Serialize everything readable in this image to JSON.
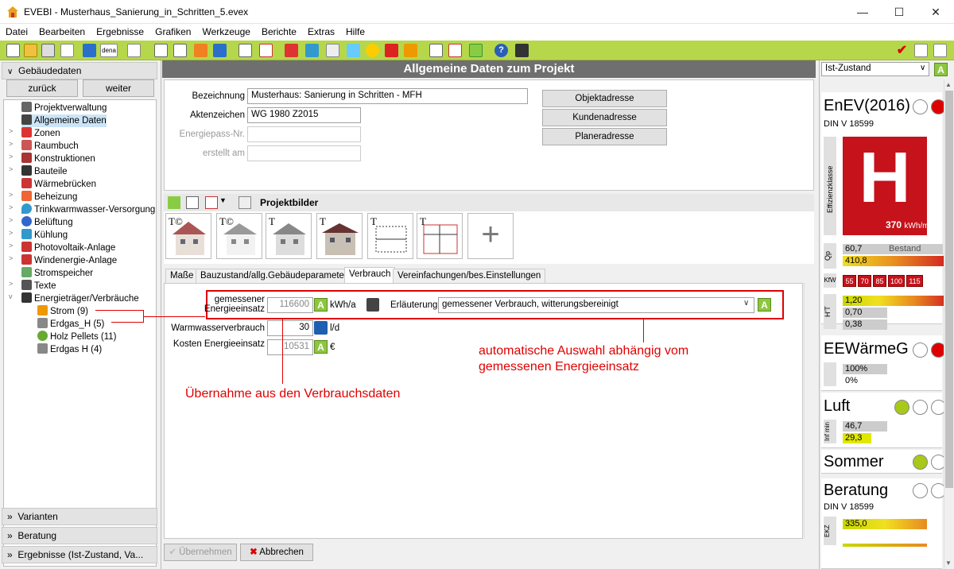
{
  "window": {
    "title": "EVEBI - Musterhaus_Sanierung_in_Schritten_5.evex",
    "minimize": "—",
    "maximize": "☐",
    "close": "✕"
  },
  "menu": [
    "Datei",
    "Bearbeiten",
    "Ergebnisse",
    "Grafiken",
    "Werkzeuge",
    "Berichte",
    "Extras",
    "Hilfe"
  ],
  "left": {
    "header": "Gebäudedaten",
    "back": "zurück",
    "forward": "weiter",
    "tree": [
      {
        "label": "Projektverwaltung",
        "color": "#555"
      },
      {
        "label": "Allgemeine Daten",
        "color": "#444"
      },
      {
        "label": "Zonen",
        "color": "#d33"
      },
      {
        "label": "Raumbuch",
        "color": "#c55"
      },
      {
        "label": "Konstruktionen",
        "color": "#a33"
      },
      {
        "label": "Bauteile",
        "color": "#333"
      },
      {
        "label": "Wärmebrücken",
        "color": "#c33"
      },
      {
        "label": "Beheizung",
        "color": "#e63"
      },
      {
        "label": "Trinkwarmwasser-Versorgung",
        "color": "#39c"
      },
      {
        "label": "Belüftung",
        "color": "#36c"
      },
      {
        "label": "Kühlung",
        "color": "#39c"
      },
      {
        "label": "Photovoltaik-Anlage",
        "color": "#c33"
      },
      {
        "label": "Windenergie-Anlage",
        "color": "#c33"
      },
      {
        "label": "Stromspeicher",
        "color": "#6a6"
      },
      {
        "label": "Texte",
        "color": "#555"
      },
      {
        "label": "Energieträger/Verbräuche",
        "color": "#333"
      },
      {
        "label": "Strom (9)",
        "color": "#e90"
      },
      {
        "label": "Erdgas_H (5)",
        "color": "#888"
      },
      {
        "label": "Holz Pellets (11)",
        "color": "#6a3"
      },
      {
        "label": "Erdgas H (4)",
        "color": "#888"
      }
    ],
    "sections": [
      "Varianten",
      "Beratung",
      "Ergebnisse (Ist-Zustand, Va..."
    ]
  },
  "center": {
    "header": "Allgemeine Daten zum Projekt",
    "labels": {
      "bezeichnung": "Bezeichnung",
      "aktenzeichen": "Aktenzeichen",
      "energiepass": "Energiepass-Nr.",
      "erstellt": "erstellt am"
    },
    "values": {
      "bezeichnung": "Musterhaus: Sanierung in Schritten - MFH",
      "aktenzeichen": "WG 1980 Z2015",
      "energiepass": "",
      "erstellt": ""
    },
    "buttons": [
      "Objektadresse",
      "Kundenadresse",
      "Planeradresse"
    ],
    "projektbilder": "Projektbilder",
    "add_image": "+",
    "tabs": [
      "Maße",
      "Bauzustand/allg.Gebäudeparameter",
      "Verbrauch",
      "Vereinfachungen/bes.Einstellungen"
    ],
    "verbrauch": {
      "gemessen_label": "gemessener Energieeinsatz",
      "gemessen_value": "116600",
      "gemessen_unit": "kWh/a",
      "erlaeuterung_label": "Erläuterung",
      "erlaeuterung_value": "gemessener Verbrauch, witterungsbereinigt",
      "ww_label": "Warmwasserverbrauch",
      "ww_value": "30",
      "ww_unit": "l/d",
      "kosten_label": "Kosten Energieeinsatz",
      "kosten_value": "10531",
      "kosten_unit": "€",
      "a_badge": "A"
    },
    "annotations": {
      "auto": "automatische Auswahl abhängig vom gemessenen Energieeinsatz",
      "uebernahme": "Übernahme aus den Verbrauchsdaten"
    }
  },
  "bottom": {
    "apply": "Übernehmen",
    "cancel": "Abbrechen"
  },
  "right": {
    "state": "Ist-Zustand",
    "state_badge": "A",
    "enev": {
      "title": "EnEV(2016)",
      "norm": "DIN V 18599",
      "class": "H",
      "class_axis": "Effizienzklasse",
      "value": "370",
      "unit": "kWh/m²"
    },
    "qp": {
      "label": "Qp",
      "v1": "60,7",
      "v1_note": "Bestand",
      "v2": "410,8"
    },
    "kfw": {
      "label": "KfW",
      "levels": [
        "55",
        "70",
        "85",
        "100",
        "115"
      ]
    },
    "ht": {
      "label": "H'T",
      "values": [
        "1,20",
        "0,70",
        "0,38"
      ]
    },
    "eewg": {
      "title": "EEWärmeG",
      "v1": "100%",
      "v2": "0%"
    },
    "luft": {
      "title": "Luft",
      "label": "Inf min",
      "v1": "46,7",
      "v2": "29,3"
    },
    "sommer": {
      "title": "Sommer"
    },
    "beratung": {
      "title": "Beratung",
      "norm": "DIN V 18599",
      "label": "EKZ",
      "v1": "335,0"
    }
  }
}
